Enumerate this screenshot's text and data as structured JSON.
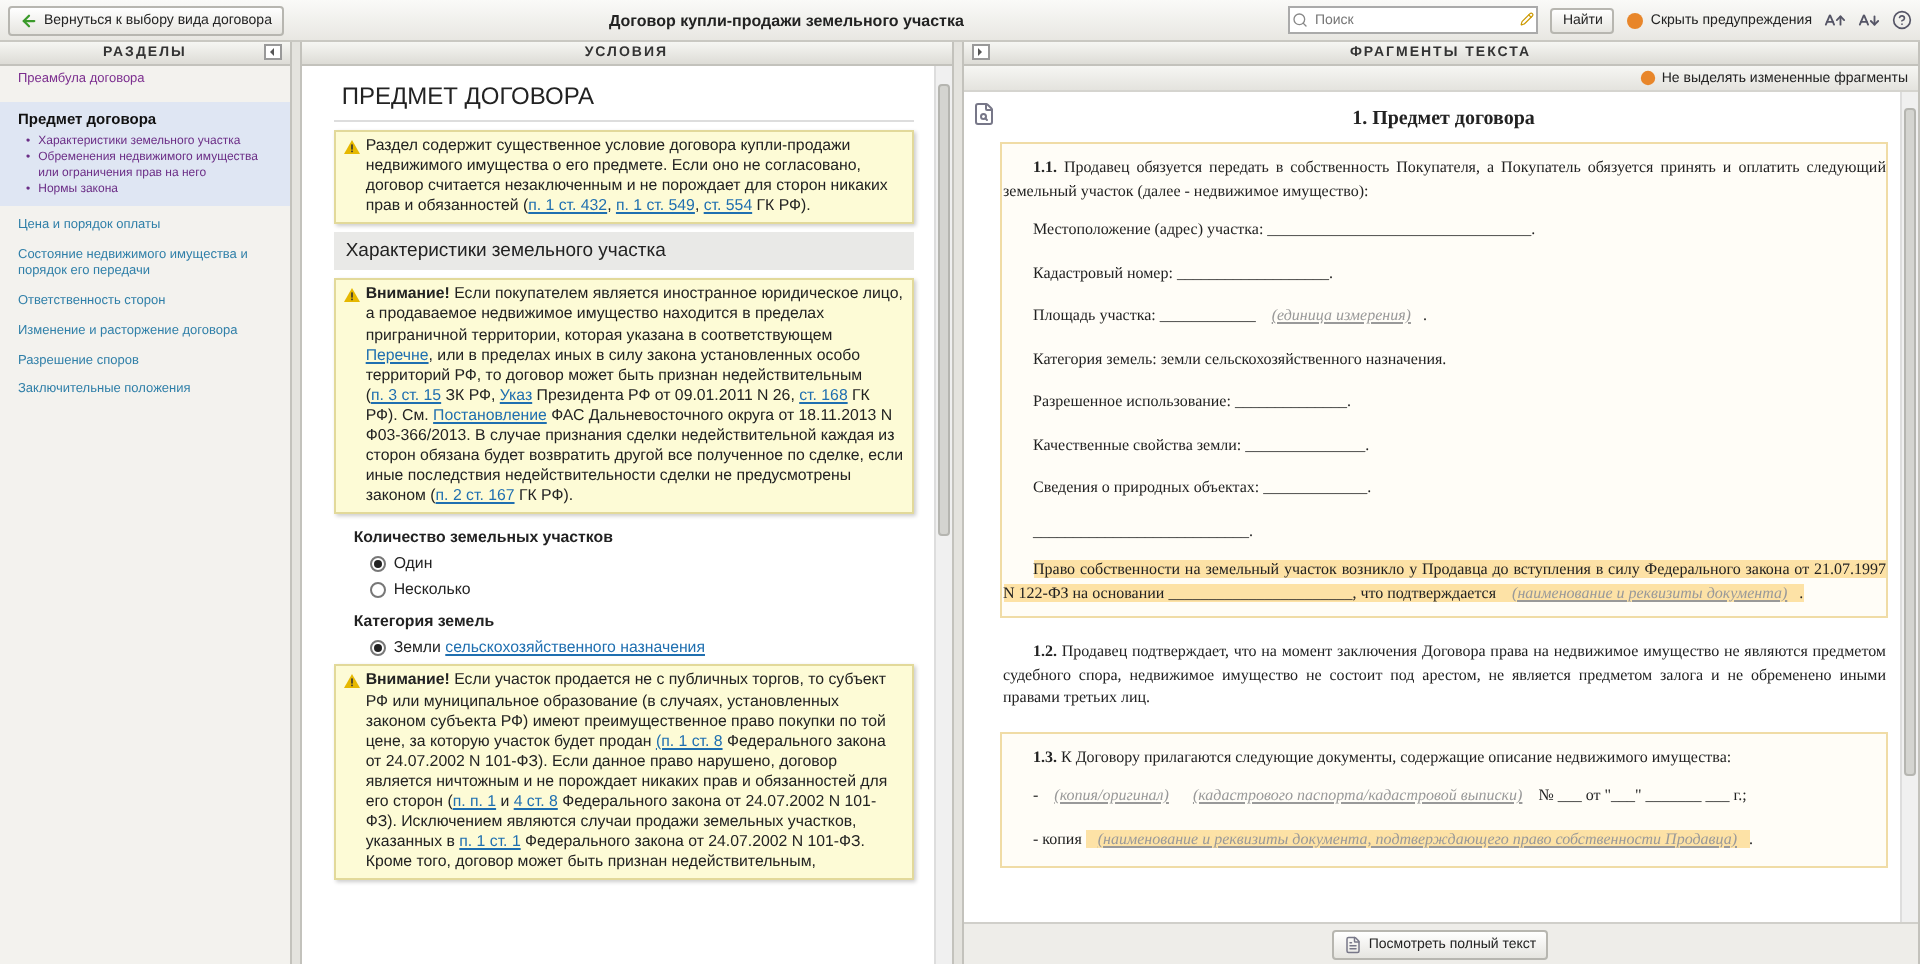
{
  "toolbar": {
    "back_button": "Вернуться к выбору вида договора",
    "title": "Договор купли-продажи земельного участка",
    "search": {
      "placeholder": "Поиск"
    },
    "find_button": "Найти",
    "hide_warnings": "Скрыть предупреждения"
  },
  "sections": {
    "heading": "РАЗДЕЛЫ",
    "items": [
      {
        "label": "Преамбула договора",
        "selected": false,
        "visited": true
      },
      {
        "label": "Предмет договора",
        "selected": true,
        "visited": false,
        "children": [
          {
            "marker": "•",
            "label": "Характеристики земельного участка"
          },
          {
            "marker": "•",
            "label": "Обременения недвижимого имущества или ограничения прав на него"
          },
          {
            "marker": "•",
            "label": "Нормы закона"
          }
        ]
      },
      {
        "label": "Цена и порядок оплаты",
        "selected": false,
        "visited": false
      },
      {
        "label": "Состояние недвижимого имущества и порядок его передачи",
        "selected": false,
        "visited": false
      },
      {
        "label": "Ответственность сторон",
        "selected": false,
        "visited": false
      },
      {
        "label": "Изменение и расторжение договора",
        "selected": false,
        "visited": false
      },
      {
        "label": "Разрешение споров",
        "selected": false,
        "visited": false
      },
      {
        "label": "Заключительные положения",
        "selected": false,
        "visited": false
      }
    ]
  },
  "conditions": {
    "heading": "УСЛОВИЯ",
    "blocks": [
      {
        "kind": "heading",
        "text": "ПРЕДМЕТ ДОГОВОРА"
      },
      {
        "kind": "note",
        "segments": [
          {
            "kind": "text",
            "text": "Раздел содержит существенное условие договора купли-продажи недвижимого имущества о его предмете. Если оно не согласовано, договор считается незаключенным и не порождает для сторон никаких прав и обязанностей ("
          },
          {
            "kind": "link",
            "text": "п. 1 ст. 432"
          },
          {
            "kind": "text",
            "text": ", "
          },
          {
            "kind": "link",
            "text": "п. 1 ст. 549"
          },
          {
            "kind": "text",
            "text": ", "
          },
          {
            "kind": "link",
            "text": "ст. 554"
          },
          {
            "kind": "text",
            "text": " ГК РФ)."
          }
        ]
      },
      {
        "kind": "subheading",
        "text": "Характеристики земельного участка"
      },
      {
        "kind": "note",
        "segments": [
          {
            "kind": "bold",
            "text": "Внимание!"
          },
          {
            "kind": "text",
            "text": " Если покупателем является иностранное юридическое лицо, а продаваемое недвижимое имущество находится в пределах приграничной территории, которая указана в соответствующем "
          },
          {
            "kind": "link",
            "text": "Перечне"
          },
          {
            "kind": "text",
            "text": ", или в пределах иных в силу закона установленных особо территорий РФ, то договор может быть признан недействительным ("
          },
          {
            "kind": "link",
            "text": "п. 3 ст. 15"
          },
          {
            "kind": "text",
            "text": " ЗК РФ, "
          },
          {
            "kind": "link",
            "text": "Указ"
          },
          {
            "kind": "text",
            "text": " Президента РФ от 09.01.2011 N 26, "
          },
          {
            "kind": "link",
            "text": "ст. 168"
          },
          {
            "kind": "text",
            "text": " ГК РФ). См. "
          },
          {
            "kind": "link",
            "text": "Постановление"
          },
          {
            "kind": "text",
            "text": " ФАС Дальневосточного округа от 18.11.2013 N Ф03-366/2013. В случае признания сделки недействительной каждая из сторон обязана будет возвратить другой все полученное по сделке, если иные последствия недействительности сделки не предусмотрены законом ("
          },
          {
            "kind": "link",
            "text": "п. 2 ст. 167"
          },
          {
            "kind": "text",
            "text": " ГК РФ)."
          }
        ]
      },
      {
        "kind": "question",
        "text": "Количество земельных участков"
      },
      {
        "kind": "option",
        "selected": true,
        "segments": [
          {
            "kind": "text",
            "text": "Один"
          }
        ]
      },
      {
        "kind": "option",
        "selected": false,
        "segments": [
          {
            "kind": "text",
            "text": "Несколько"
          }
        ]
      },
      {
        "kind": "question",
        "text": "Категория земель"
      },
      {
        "kind": "option",
        "selected": true,
        "segments": [
          {
            "kind": "text",
            "text": "Земли "
          },
          {
            "kind": "link",
            "text": "сельскохозяйственного назначения"
          }
        ]
      },
      {
        "kind": "note",
        "segments": [
          {
            "kind": "bold",
            "text": "Внимание!"
          },
          {
            "kind": "text",
            "text": " Если участок продается не с публичных торгов, то субъект РФ или муниципальное образование (в случаях, установленных законом субъекта РФ) имеют преимущественное право покупки по той цене, за которую участок будет продан "
          },
          {
            "kind": "link",
            "text": "(п. 1 ст. 8"
          },
          {
            "kind": "text",
            "text": " Федерального закона от 24.07.2002 N 101-ФЗ). Если данное право нарушено, договор является ничтожным и не порождает никаких прав и обязанностей для его сторон ("
          },
          {
            "kind": "link",
            "text": "п. п. 1"
          },
          {
            "kind": "text",
            "text": " и "
          },
          {
            "kind": "link",
            "text": "4 ст. 8"
          },
          {
            "kind": "text",
            "text": " Федерального закона от 24.07.2002 N 101-ФЗ). Исключением являются случаи продажи земельных участков, указанных в "
          },
          {
            "kind": "link",
            "text": "п. 1 ст. 1"
          },
          {
            "kind": "text",
            "text": " Федерального закона от 24.07.2002 N 101-ФЗ. Кроме того, договор может быть признан недействительным,"
          }
        ]
      }
    ]
  },
  "fragments": {
    "heading": "ФРАГМЕНТЫ ТЕКСТА",
    "toggle": "Не выделять измененные фрагменты",
    "title": "1. Предмет договора",
    "blocks": [
      {
        "framed": true,
        "paragraphs": [
          {
            "kind": "lead",
            "highlighted": false,
            "segments": [
              {
                "kind": "bold",
                "text": "1.1."
              },
              {
                "kind": "text",
                "text": " Продавец обязуется передать в собственность Покупателя, а Покупатель обязуется принять и оплатить следующий земельный участок (далее - недвижимое имущество):"
              }
            ]
          },
          {
            "kind": "field",
            "highlighted": false,
            "segments": [
              {
                "kind": "text",
                "text": "Местоположение (адрес) участка: _________________________________."
              }
            ]
          },
          {
            "kind": "field",
            "highlighted": false,
            "segments": [
              {
                "kind": "text",
                "text": "Кадастровый номер: ___________________."
              }
            ]
          },
          {
            "kind": "field",
            "highlighted": false,
            "segments": [
              {
                "kind": "text",
                "text": "Площадь участка: ____________ "
              },
              {
                "kind": "hint",
                "text": "(единица измерения)"
              },
              {
                "kind": "text",
                "text": "."
              }
            ]
          },
          {
            "kind": "field",
            "highlighted": false,
            "segments": [
              {
                "kind": "text",
                "text": "Категория земель: земли сельскохозяйственного назначения."
              }
            ]
          },
          {
            "kind": "field",
            "highlighted": false,
            "segments": [
              {
                "kind": "text",
                "text": "Разрешенное использование: ______________."
              }
            ]
          },
          {
            "kind": "field",
            "highlighted": false,
            "segments": [
              {
                "kind": "text",
                "text": "Качественные свойства земли: _______________."
              }
            ]
          },
          {
            "kind": "field",
            "highlighted": false,
            "segments": [
              {
                "kind": "text",
                "text": "Сведения о природных объектах: _____________."
              }
            ]
          },
          {
            "kind": "field",
            "highlighted": false,
            "segments": [
              {
                "kind": "text",
                "text": "___________________________."
              }
            ]
          },
          {
            "kind": "lead",
            "highlighted": true,
            "segments": [
              {
                "kind": "text",
                "text": "Право собственности на земельный участок возникло у Продавца до вступления в силу Федерального закона от 21.07.1997 N 122-ФЗ на основании _______________________, что подтверждается "
              },
              {
                "kind": "hint",
                "text": "(наименование и реквизиты документа)"
              },
              {
                "kind": "text",
                "text": "."
              }
            ]
          }
        ]
      },
      {
        "framed": false,
        "paragraphs": [
          {
            "kind": "lead",
            "highlighted": false,
            "segments": [
              {
                "kind": "bold",
                "text": "1.2."
              },
              {
                "kind": "text",
                "text": " Продавец подтверждает, что на момент заключения Договора права на недвижимое имущество не являются предметом судебного спора, недвижимое имущество не состоит под арестом, не является предметом залога и не обременено иными правами третьих лиц."
              }
            ]
          }
        ]
      },
      {
        "framed": true,
        "paragraphs": [
          {
            "kind": "lead",
            "highlighted": false,
            "segments": [
              {
                "kind": "bold",
                "text": "1.3."
              },
              {
                "kind": "text",
                "text": " К Договору прилагаются следующие документы, содержащие описание недвижимого имущества:"
              }
            ]
          },
          {
            "kind": "field",
            "highlighted": false,
            "segments": [
              {
                "kind": "text",
                "text": "- "
              },
              {
                "kind": "hint",
                "text": "(копия/оригинал)"
              },
              {
                "kind": "hint",
                "text": "(кадастрового паспорта/кадастровой выписки)"
              },
              {
                "kind": "text",
                "text": " № ___ от \"___\" _______ ___ г.;"
              }
            ]
          },
          {
            "kind": "field",
            "highlighted": false,
            "segments": [
              {
                "kind": "text",
                "text": "- копия "
              },
              {
                "kind": "marked_hint",
                "text": "(наименование и реквизиты документа, подтверждающего право собственности Продавца)"
              },
              {
                "kind": "text",
                "text": "."
              }
            ]
          }
        ]
      }
    ],
    "full_text_button": "Посмотреть полный текст"
  }
}
